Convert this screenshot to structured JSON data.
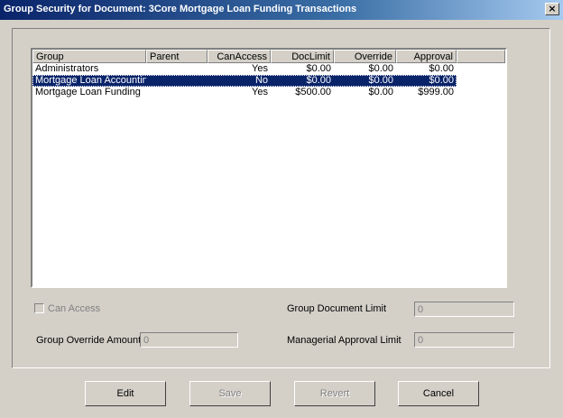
{
  "window": {
    "title": "Group Security for Document: 3Core Mortgage Loan Funding Transactions",
    "close_glyph": "×"
  },
  "list": {
    "columns": [
      "Group",
      "Parent",
      "CanAccess",
      "DocLimit",
      "Override",
      "Approval"
    ],
    "rows": [
      {
        "group": "Administrators",
        "parent": "",
        "can_access": "Yes",
        "doc_limit": "$0.00",
        "override": "$0.00",
        "approval": "$0.00",
        "selected": false
      },
      {
        "group": "Mortgage Loan Accounting",
        "parent": "",
        "can_access": "No",
        "doc_limit": "$0.00",
        "override": "$0.00",
        "approval": "$0.00",
        "selected": true
      },
      {
        "group": "Mortgage Loan Funding",
        "parent": "",
        "can_access": "Yes",
        "doc_limit": "$500.00",
        "override": "$0.00",
        "approval": "$999.00",
        "selected": false
      }
    ]
  },
  "form": {
    "can_access_label": "Can Access",
    "group_document_limit_label": "Group Document Limit",
    "group_document_limit_value": "0",
    "group_override_amount_label": "Group Override Amount",
    "group_override_amount_value": "0",
    "managerial_approval_limit_label": "Managerial Approval Limit",
    "managerial_approval_limit_value": "0"
  },
  "buttons": {
    "edit": "Edit",
    "save": "Save",
    "revert": "Revert",
    "cancel": "Cancel"
  }
}
